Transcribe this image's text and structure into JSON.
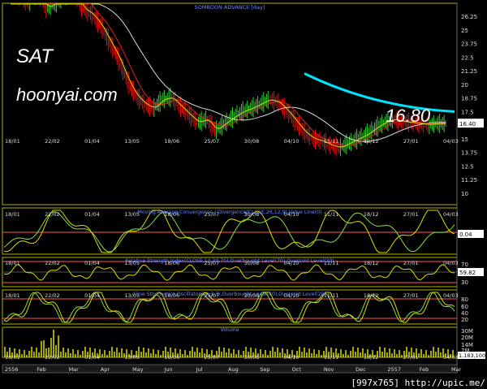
{
  "header": {
    "title": "SOMBOON ADVANCE [day]"
  },
  "watermark": {
    "symbol": "SAT",
    "site": "hoonyai.com",
    "target": "16.80"
  },
  "footer": "[997x765] http://upic.me/",
  "panels": {
    "macd": "Moving Average Convergence / Divergence(CLOSE,26,12,9),Value Line(0)",
    "rsi": "Relative Strength Index(CLOSE,14,30,70),Overbought Level(70),Oversold Level(30)",
    "stoch": "Slow Stochastics Oscillator(14,3,3),Overbought Level(80),Oversold Level(20)",
    "volume": "Volume"
  },
  "colors": {
    "up": "#32cd32",
    "down": "#e01010",
    "ma_fast": "#dddd00",
    "ma_mid": "#dd2222",
    "ma_slow": "#dddddd",
    "trend": "#00e5ff",
    "panel_border": "#b0b000"
  },
  "chart_data": {
    "type": "line",
    "price": {
      "x": [
        "18/01",
        "22/02",
        "01/04",
        "13/05",
        "18/06",
        "25/07",
        "30/08",
        "04/10",
        "11/11",
        "18/12",
        "27/01",
        "04/03"
      ],
      "y_ticks": [
        "26.25",
        "25",
        "23.75",
        "22.5",
        "21.25",
        "20",
        "18.75",
        "17.5",
        "16.25",
        "15",
        "13.75",
        "12.5",
        "11.25",
        "10"
      ],
      "last": "16.40",
      "close": [
        29,
        28,
        27.5,
        28.5,
        27,
        27.5,
        28,
        29,
        27,
        26.5,
        25.5,
        24,
        22.5,
        20.5,
        19,
        18.2,
        17.8,
        18.6,
        18.8,
        18.0,
        17.2,
        16.5,
        16.8,
        15.8,
        16.4,
        17.0,
        17.5,
        17.8,
        18.2,
        18.6,
        18.4,
        17.6,
        16.6,
        15.6,
        15.0,
        14.8,
        14.4,
        14.2,
        14.6,
        15.0,
        15.4,
        16.0,
        16.5,
        16.8,
        16.6,
        16.5,
        16.4,
        16.3,
        16.4,
        16.4
      ]
    },
    "trendline": {
      "from": 21.0,
      "to": 17.5
    },
    "macd": {
      "level": "0.04"
    },
    "rsi": {
      "ticks": [
        "70",
        "50",
        "30"
      ],
      "last": "59.82"
    },
    "stoch": {
      "ticks": [
        "80",
        "60",
        "40",
        "20"
      ]
    },
    "volume": {
      "ticks": [
        "30M",
        "20M",
        "14M",
        "7M"
      ],
      "last": "1,183,100"
    },
    "months": [
      "2556",
      "Feb",
      "Mar",
      "Apr",
      "May",
      "Jun",
      "Jul",
      "Aug",
      "Sep",
      "Oct",
      "Nov",
      "Dec",
      "2557",
      "Feb",
      "Mar"
    ]
  }
}
